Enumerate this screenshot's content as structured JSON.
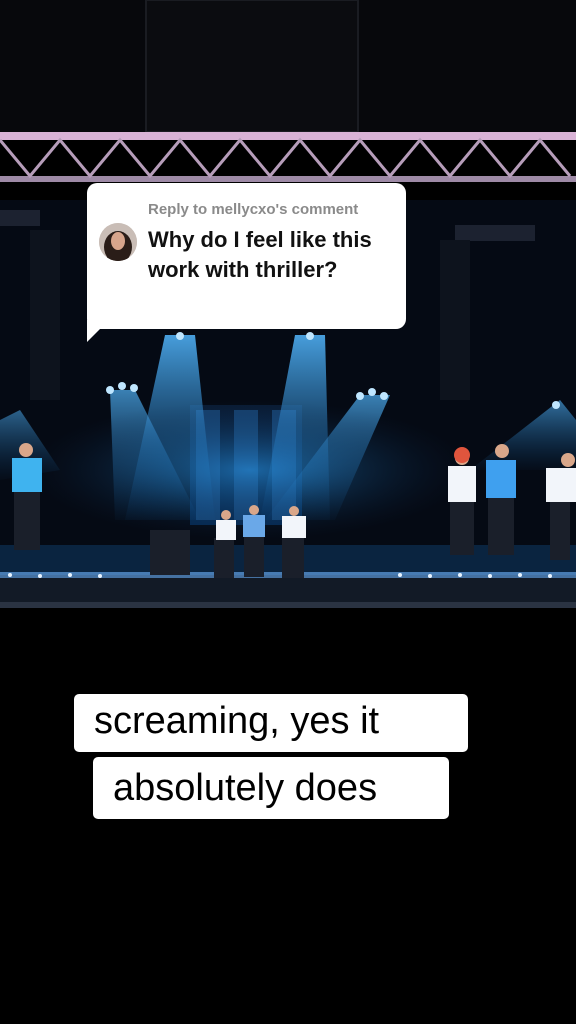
{
  "reply": {
    "header": "Reply to mellycxo's comment",
    "comment": "Why do I feel like this work with thriller?"
  },
  "caption": {
    "line1": "screaming, yes it",
    "line2": "absolutely does"
  },
  "colors": {
    "stage_light": "#1e8ee0",
    "caption_bg": "#ffffff",
    "background": "#000000"
  },
  "icons": [
    "avatar"
  ]
}
